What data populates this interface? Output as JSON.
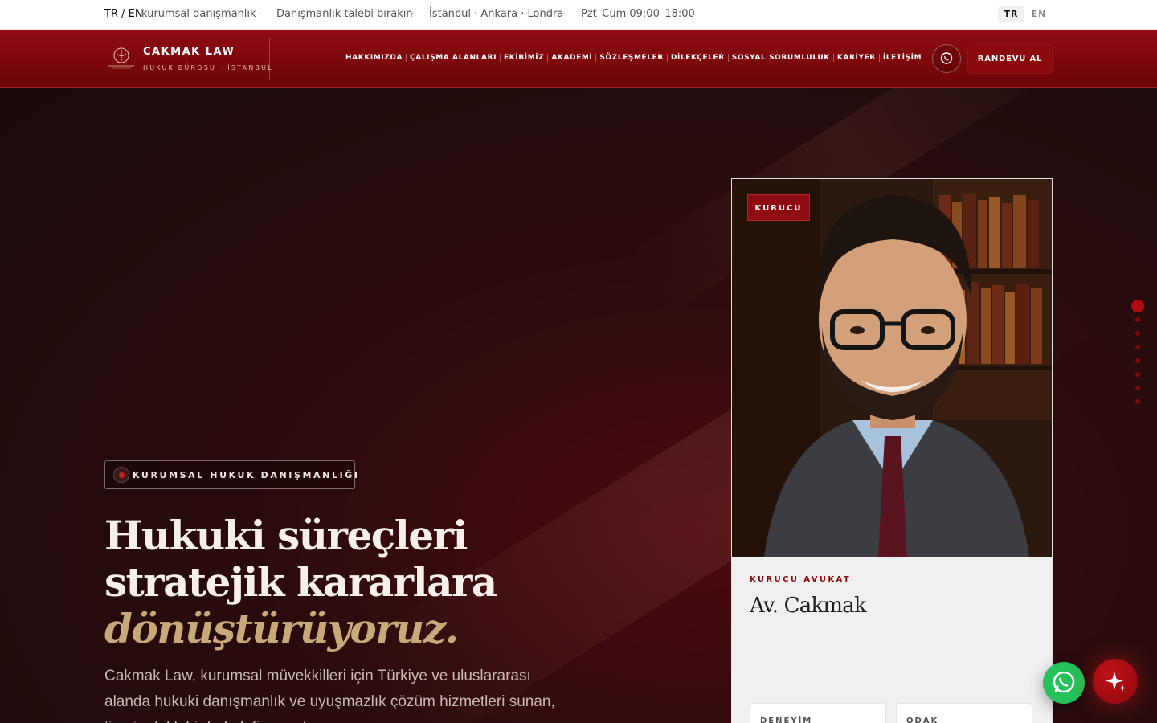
{
  "topbar": {
    "lang_prefix": "TR / EN",
    "tagline": "kurumsal danışmanlık",
    "consult": "Danışmanlık talebi bırakın",
    "cities": "İstanbul · Ankara · Londra",
    "hours": "Pzt–Cum 09:00–18:00",
    "lang_tr": "TR",
    "lang_en": "EN"
  },
  "nav": {
    "brand": "CAKMAK LAW",
    "brand_sub": "HUKUK BÜROSU · İSTANBUL",
    "links": [
      "HAKKIMIZDA",
      "ÇALIŞMA ALANLARI",
      "EKİBİMİZ",
      "AKADEMİ",
      "SÖZLEŞMELER",
      "DİLEKÇELER",
      "SOSYAL SORUMLULUK",
      "KARİYER",
      "İLETİŞİM"
    ],
    "cta": "RANDEVU AL"
  },
  "hero": {
    "badge": "KURUMSAL HUKUK DANIŞMANLIĞI",
    "headline_line1": "Hukuki süreçleri",
    "headline_line2": "stratejik kararlara",
    "headline_accent": "dönüştürüyoruz.",
    "lead": "Cakmak Law, kurumsal müvekkilleri için Türkiye ve uluslararası alanda hukuki danışmanlık ve uyuşmazlık çözüm hizmetleri sunan, ticari odaklı bir hukuk firmasıdır."
  },
  "card": {
    "badge": "KURUCU",
    "role": "KURUCU AVUKAT",
    "name": "Av. Cakmak",
    "stat1": "DENEYİM",
    "stat2": "ODAK"
  },
  "colors": {
    "brand_red": "#8e0c10",
    "accent_gold": "#c9a97a",
    "hero_bg": "#1c0b0c",
    "whatsapp_green": "#25c15a"
  }
}
